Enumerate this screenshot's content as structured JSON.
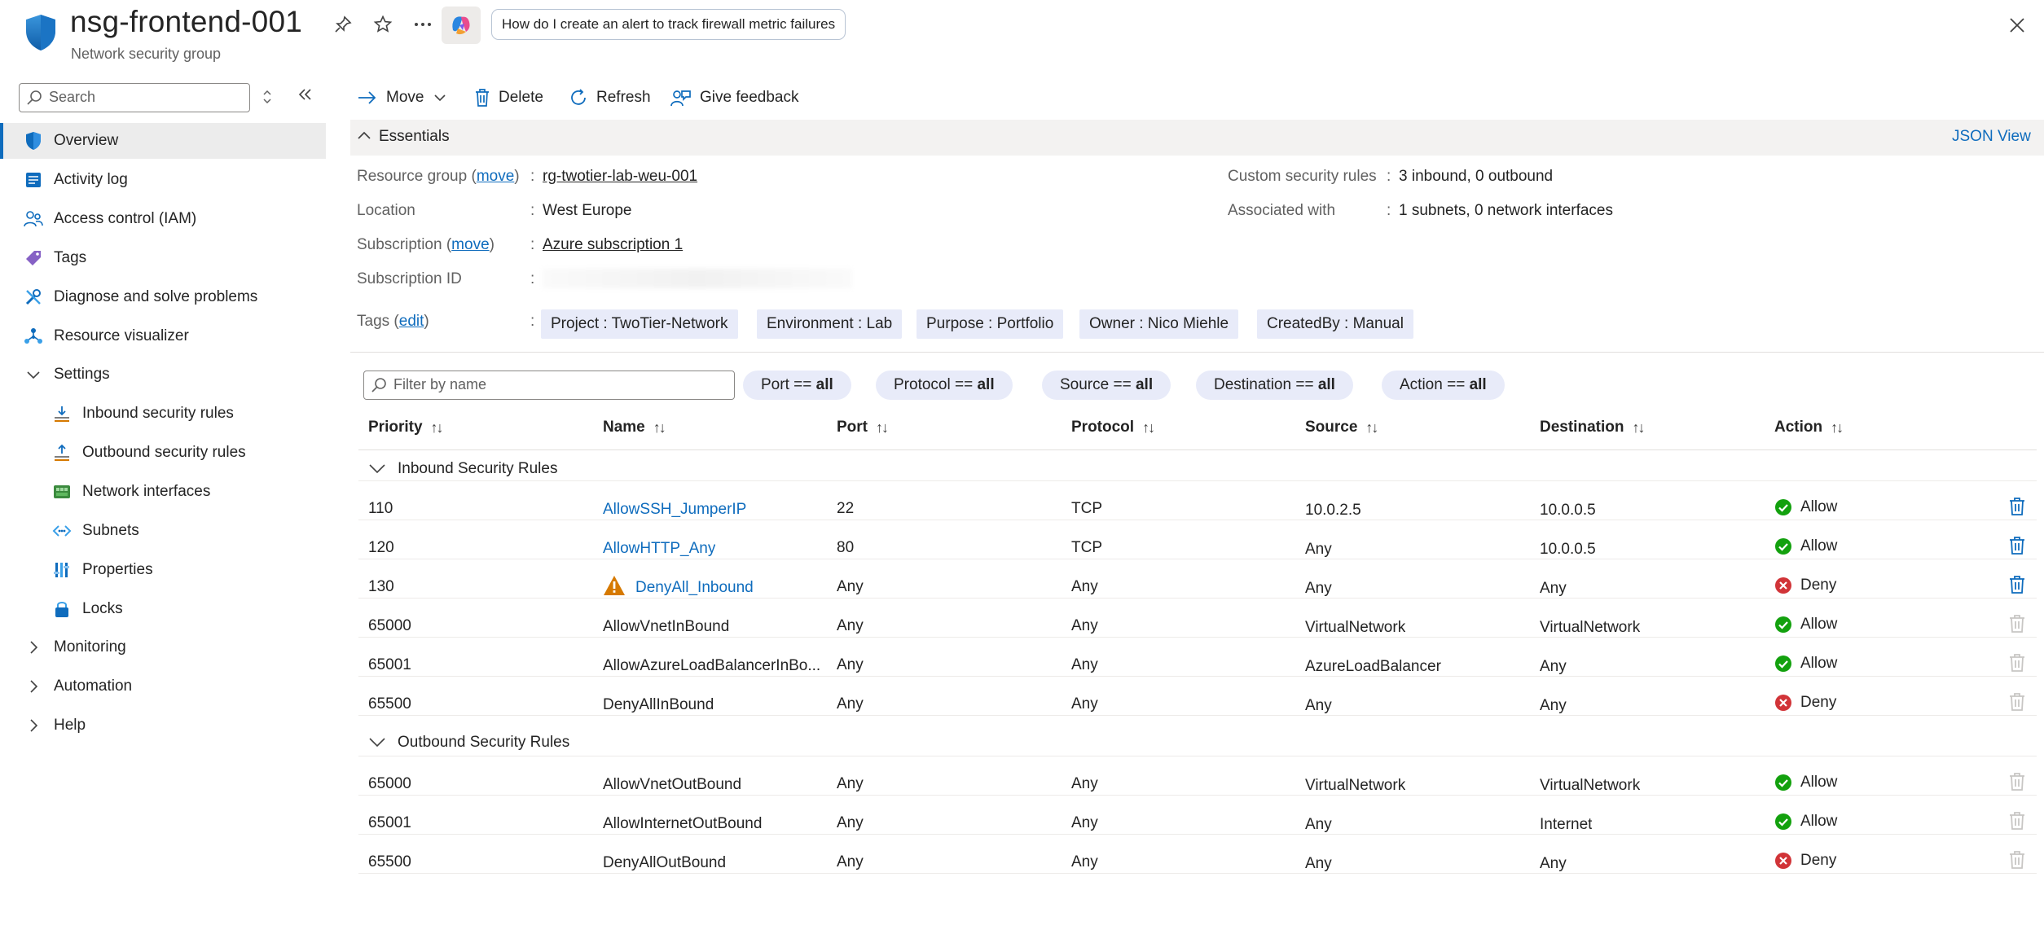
{
  "header": {
    "title": "nsg-frontend-001",
    "subtitle": "Network security group",
    "copilot_prompt": "How do I create an alert to track firewall metric failures",
    "icons": [
      "pin-icon",
      "star-icon",
      "more-icon",
      "copilot-icon",
      "close-icon"
    ]
  },
  "sidebar": {
    "search_placeholder": "Search",
    "items": [
      {
        "label": "Overview",
        "icon": "shield-icon"
      },
      {
        "label": "Activity log",
        "icon": "activity-log-icon"
      },
      {
        "label": "Access control (IAM)",
        "icon": "people-icon"
      },
      {
        "label": "Tags",
        "icon": "tag-icon"
      },
      {
        "label": "Diagnose and solve problems",
        "icon": "wrench-icon"
      },
      {
        "label": "Resource visualizer",
        "icon": "hierarchy-icon"
      },
      {
        "label": "Settings",
        "icon": "chevron-down-icon"
      },
      {
        "label": "Inbound security rules",
        "icon": "inbound-rules-icon"
      },
      {
        "label": "Outbound security rules",
        "icon": "outbound-rules-icon"
      },
      {
        "label": "Network interfaces",
        "icon": "network-interface-icon"
      },
      {
        "label": "Subnets",
        "icon": "subnet-icon"
      },
      {
        "label": "Properties",
        "icon": "properties-icon"
      },
      {
        "label": "Locks",
        "icon": "lock-icon"
      },
      {
        "label": "Monitoring",
        "icon": "chevron-right-icon"
      },
      {
        "label": "Automation",
        "icon": "chevron-right-icon"
      },
      {
        "label": "Help",
        "icon": "chevron-right-icon"
      }
    ]
  },
  "toolbar": {
    "move": "Move",
    "delete": "Delete",
    "refresh": "Refresh",
    "feedback": "Give feedback"
  },
  "essentials": {
    "title": "Essentials",
    "json_view": "JSON View",
    "resource_group_label": "Resource group",
    "move_link": "move",
    "resource_group_value": "rg-twotier-lab-weu-001",
    "location_label": "Location",
    "location_value": "West Europe",
    "subscription_label": "Subscription",
    "subscription_value": "Azure subscription 1",
    "subscription_id_label": "Subscription ID",
    "tags_label": "Tags",
    "edit_link": "edit",
    "custom_rules_label": "Custom security rules",
    "custom_rules_value": "3 inbound, 0 outbound",
    "associated_label": "Associated with",
    "associated_value": "1 subnets, 0 network interfaces",
    "tags": [
      "Project : TwoTier-Network",
      "Environment : Lab",
      "Purpose : Portfolio",
      "Owner : Nico Miehle",
      "CreatedBy : Manual"
    ]
  },
  "filters": {
    "placeholder": "Filter by name",
    "pills": [
      {
        "name": "Port",
        "op": "==",
        "value": "all"
      },
      {
        "name": "Protocol",
        "op": "==",
        "value": "all"
      },
      {
        "name": "Source",
        "op": "==",
        "value": "all"
      },
      {
        "name": "Destination",
        "op": "==",
        "value": "all"
      },
      {
        "name": "Action",
        "op": "==",
        "value": "all"
      }
    ]
  },
  "table": {
    "columns": [
      "Priority",
      "Name",
      "Port",
      "Protocol",
      "Source",
      "Destination",
      "Action"
    ],
    "inbound_group": "Inbound Security Rules",
    "outbound_group": "Outbound Security Rules",
    "inbound": [
      {
        "priority": "110",
        "name": "AllowSSH_JumperIP",
        "port": "22",
        "protocol": "TCP",
        "source": "10.0.2.5",
        "destination": "10.0.0.5",
        "action": "Allow",
        "custom": true,
        "warning": false
      },
      {
        "priority": "120",
        "name": "AllowHTTP_Any",
        "port": "80",
        "protocol": "TCP",
        "source": "Any",
        "destination": "10.0.0.5",
        "action": "Allow",
        "custom": true,
        "warning": false
      },
      {
        "priority": "130",
        "name": "DenyAll_Inbound",
        "port": "Any",
        "protocol": "Any",
        "source": "Any",
        "destination": "Any",
        "action": "Deny",
        "custom": true,
        "warning": true
      },
      {
        "priority": "65000",
        "name": "AllowVnetInBound",
        "port": "Any",
        "protocol": "Any",
        "source": "VirtualNetwork",
        "destination": "VirtualNetwork",
        "action": "Allow",
        "custom": false,
        "warning": false
      },
      {
        "priority": "65001",
        "name": "AllowAzureLoadBalancerInBo...",
        "port": "Any",
        "protocol": "Any",
        "source": "AzureLoadBalancer",
        "destination": "Any",
        "action": "Allow",
        "custom": false,
        "warning": false
      },
      {
        "priority": "65500",
        "name": "DenyAllInBound",
        "port": "Any",
        "protocol": "Any",
        "source": "Any",
        "destination": "Any",
        "action": "Deny",
        "custom": false,
        "warning": false
      }
    ],
    "outbound": [
      {
        "priority": "65000",
        "name": "AllowVnetOutBound",
        "port": "Any",
        "protocol": "Any",
        "source": "VirtualNetwork",
        "destination": "VirtualNetwork",
        "action": "Allow",
        "custom": false,
        "warning": false
      },
      {
        "priority": "65001",
        "name": "AllowInternetOutBound",
        "port": "Any",
        "protocol": "Any",
        "source": "Any",
        "destination": "Internet",
        "action": "Allow",
        "custom": false,
        "warning": false
      },
      {
        "priority": "65500",
        "name": "DenyAllOutBound",
        "port": "Any",
        "protocol": "Any",
        "source": "Any",
        "destination": "Any",
        "action": "Deny",
        "custom": false,
        "warning": false
      }
    ]
  },
  "colors": {
    "accent": "#0f6cbd",
    "allow": "#13a10e",
    "deny": "#d13438",
    "warning": "#d67900"
  }
}
